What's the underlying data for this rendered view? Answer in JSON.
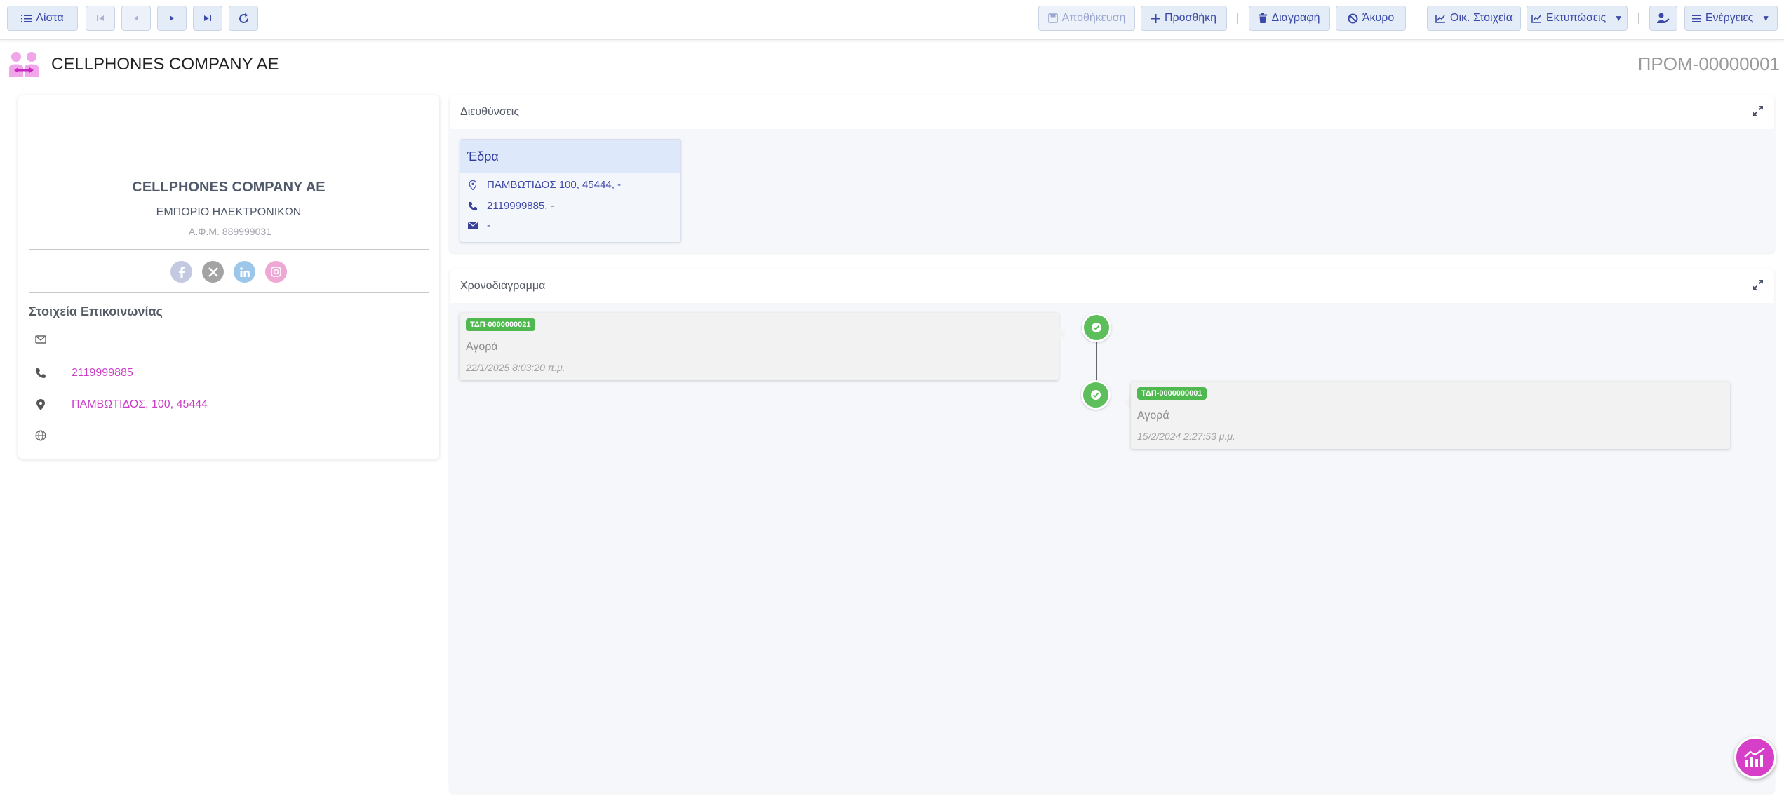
{
  "toolbar": {
    "list_label": "Λίστα",
    "save_label": "Αποθήκευση",
    "add_label": "Προσθήκη",
    "delete_label": "Διαγραφή",
    "cancel_label": "Άκυρο",
    "financial_label": "Οικ. Στοιχεία",
    "prints_label": "Εκτυπώσεις",
    "actions_label": "Ενέργειες"
  },
  "header": {
    "company_name": "CELLPHONES COMPANY AE",
    "record_code": "ΠΡΟΜ-00000001"
  },
  "profile": {
    "name": "CELLPHONES COMPANY AE",
    "activity": "ΕΜΠΟΡΙΟ ΗΛΕΚΤΡΟΝΙΚΩΝ",
    "vat_label": "Α.Φ.Μ.",
    "vat": "889999031",
    "socials": [
      "facebook-icon",
      "x-icon",
      "linkedin-icon",
      "instagram-icon"
    ],
    "contact_title": "Στοιχεία Επικοινωνίας",
    "email": "",
    "phone": "2119999885",
    "address": "ΠΑΜΒΩΤΙΔΟΣ, 100, 45444",
    "website": ""
  },
  "addresses": {
    "title": "Διευθύνσεις",
    "cards": [
      {
        "name": "Έδρα",
        "address": "ΠΑΜΒΩΤΙΔΟΣ 100, 45444, -",
        "phone": "2119999885, -",
        "email": "-"
      }
    ]
  },
  "timeline": {
    "title": "Χρονοδιάγραμμα",
    "items": [
      {
        "code": "ΤΔΠ-0000000021",
        "type": "Αγορά",
        "date": "22/1/2025 8:03:20 π.μ."
      },
      {
        "code": "ΤΔΠ-0000000001",
        "type": "Αγορά",
        "date": "15/2/2024 2:27:53 μ.μ."
      }
    ]
  },
  "colors": {
    "accent": "#3b4aa8",
    "button_bg": "#e4ecf7",
    "link": "#cc3ec8",
    "badge": "#4fb94f",
    "fab": "#d63fc8"
  }
}
